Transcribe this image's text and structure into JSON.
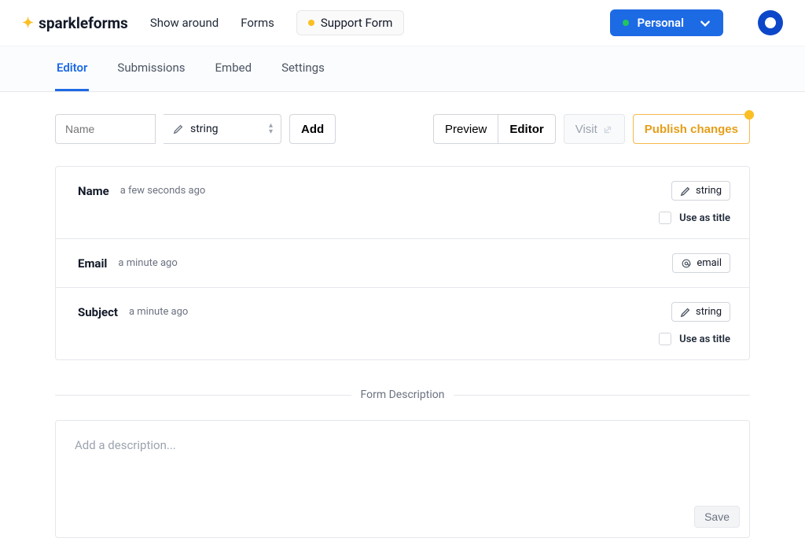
{
  "brand": "sparkleforms",
  "header": {
    "show_around": "Show around",
    "forms": "Forms",
    "current_form": "Support Form",
    "personal": "Personal"
  },
  "tabs": {
    "editor": "Editor",
    "submissions": "Submissions",
    "embed": "Embed",
    "settings": "Settings"
  },
  "toolbar": {
    "name_placeholder": "Name",
    "type_value": "string",
    "add": "Add",
    "preview": "Preview",
    "editor": "Editor",
    "visit": "Visit",
    "publish": "Publish changes"
  },
  "fields": [
    {
      "name": "Name",
      "time": "a few seconds ago",
      "type_label": "string",
      "type_icon": "pencil",
      "show_title_toggle": true,
      "title_label": "Use as title"
    },
    {
      "name": "Email",
      "time": "a minute ago",
      "type_label": "email",
      "type_icon": "at",
      "show_title_toggle": false
    },
    {
      "name": "Subject",
      "time": "a minute ago",
      "type_label": "string",
      "type_icon": "pencil",
      "show_title_toggle": true,
      "title_label": "Use as title"
    }
  ],
  "section": {
    "divider": "Form Description"
  },
  "description": {
    "placeholder": "Add a description...",
    "save": "Save"
  }
}
